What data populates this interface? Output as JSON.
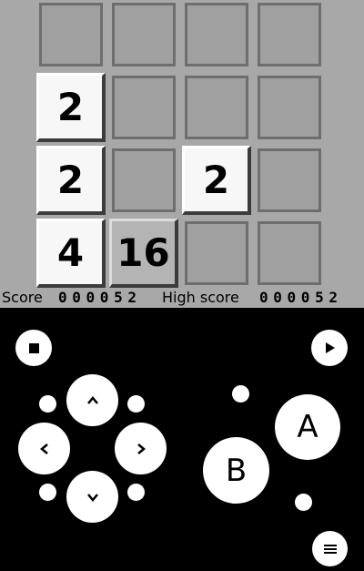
{
  "game": {
    "grid": [
      [
        "",
        "",
        "",
        ""
      ],
      [
        "2",
        "",
        "",
        ""
      ],
      [
        "2",
        "",
        "2",
        ""
      ],
      [
        "4",
        "16",
        "",
        ""
      ]
    ],
    "score_label": "Score",
    "score_value": "0 0 0 0 5 2",
    "high_score_label": "High score",
    "high_score_value": "0 0 0 0 5 2"
  },
  "controls": {
    "a_label": "A",
    "b_label": "B",
    "icons": [
      "stop-icon",
      "play-icon",
      "chevron-up-icon",
      "chevron-left-icon",
      "chevron-right-icon",
      "chevron-down-icon",
      "menu-icon"
    ]
  },
  "colors": {
    "screen_bg": "#a8a8a8",
    "tile_light": "#f7f7f7",
    "tile_mid": "#b4b4b4",
    "controls_bg": "#000000",
    "button": "#ffffff"
  }
}
